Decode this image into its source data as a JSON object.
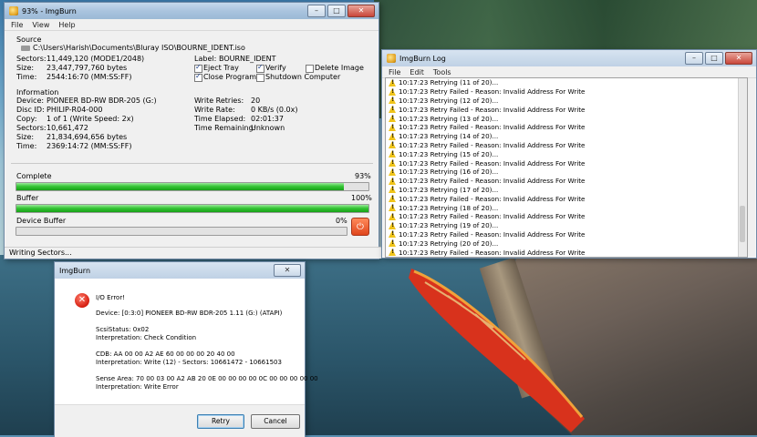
{
  "main": {
    "title": "93% - ImgBurn",
    "menu": [
      "File",
      "View",
      "Help"
    ],
    "source": {
      "heading": "Source",
      "path": "C:\\Users\\Harish\\Documents\\Bluray ISO\\BOURNE_IDENT.iso",
      "sectors_label": "Sectors:",
      "sectors": "11,449,120 (MODE1/2048)",
      "size_label": "Size:",
      "size": "23,447,797,760 bytes",
      "time_label": "Time:",
      "time": "2544:16:70 (MM:SS:FF)",
      "label_label": "Label:",
      "label": "BOURNE_IDENT"
    },
    "options": {
      "eject_tray": "Eject Tray",
      "verify": "Verify",
      "delete_image": "Delete Image",
      "close_program": "Close Program",
      "shutdown": "Shutdown Computer"
    },
    "info": {
      "heading": "Information",
      "device_label": "Device:",
      "device": "PIONEER BD-RW BDR-205 (G:)",
      "discid_label": "Disc ID:",
      "discid": "PHILIP-R04-000",
      "copy_label": "Copy:",
      "copy": "1 of 1 (Write Speed: 2x)",
      "sectors_label": "Sectors:",
      "sectors": "10,661,472",
      "size_label": "Size:",
      "size": "21,834,694,656 bytes",
      "time_label": "Time:",
      "time": "2369:14:72 (MM:SS:FF)",
      "retries_label": "Write Retries:",
      "retries": "20",
      "rate_label": "Write Rate:",
      "rate": "0 KB/s (0.0x)",
      "elapsed_label": "Time Elapsed:",
      "elapsed": "02:01:37",
      "remaining_label": "Time Remaining:",
      "remaining": "Unknown"
    },
    "progress": {
      "complete_label": "Complete",
      "complete_pct": "93%",
      "complete_value": 0.93,
      "buffer_label": "Buffer",
      "buffer_pct": "100%",
      "buffer_value": 1.0,
      "device_buffer_label": "Device Buffer",
      "device_buffer_pct": "0%",
      "device_buffer_value": 0.0
    },
    "status": "Writing Sectors..."
  },
  "log": {
    "title": "ImgBurn Log",
    "menu": [
      "File",
      "Edit",
      "Tools"
    ],
    "lines": [
      "10:17:23 Retrying (11 of 20)...",
      "10:17:23 Retry Failed - Reason: Invalid Address For Write",
      "10:17:23 Retrying (12 of 20)...",
      "10:17:23 Retry Failed - Reason: Invalid Address For Write",
      "10:17:23 Retrying (13 of 20)...",
      "10:17:23 Retry Failed - Reason: Invalid Address For Write",
      "10:17:23 Retrying (14 of 20)...",
      "10:17:23 Retry Failed - Reason: Invalid Address For Write",
      "10:17:23 Retrying (15 of 20)...",
      "10:17:23 Retry Failed - Reason: Invalid Address For Write",
      "10:17:23 Retrying (16 of 20)...",
      "10:17:23 Retry Failed - Reason: Invalid Address For Write",
      "10:17:23 Retrying (17 of 20)...",
      "10:17:23 Retry Failed - Reason: Invalid Address For Write",
      "10:17:23 Retrying (18 of 20)...",
      "10:17:23 Retry Failed - Reason: Invalid Address For Write",
      "10:17:23 Retrying (19 of 20)...",
      "10:17:23 Retry Failed - Reason: Invalid Address For Write",
      "10:17:23 Retrying (20 of 20)...",
      "10:17:23 Retry Failed - Reason: Invalid Address For Write"
    ]
  },
  "dialog": {
    "title": "ImgBurn",
    "heading": "I/O Error!",
    "device": "Device: [0:3:0] PIONEER BD-RW   BDR-205 1.11 (G:) (ATAPI)",
    "scsi_status": "ScsiStatus: 0x02",
    "interp1": "Interpretation: Check Condition",
    "cdb": "CDB: AA 00 00 A2 AE 60 00 00 00 20 40 00",
    "interp2": "Interpretation: Write (12) - Sectors: 10661472 - 10661503",
    "sense": "Sense Area: 70 00 03 00 A2 AB 20 0E 00 00 00 00 0C 00 00 00 00 00",
    "interp3": "Interpretation: Write Error",
    "retry": "Retry",
    "cancel": "Cancel"
  }
}
